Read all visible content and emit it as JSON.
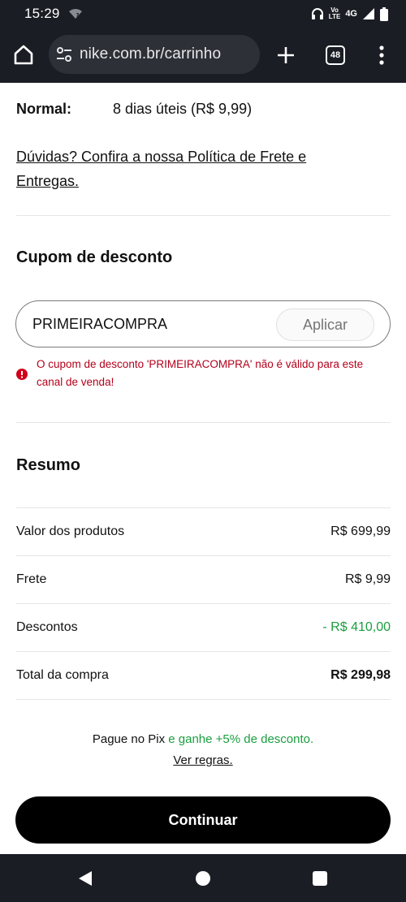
{
  "status_bar": {
    "time": "15:29",
    "network_top": "Vo",
    "network_bottom": "LTE",
    "network_type": "4G"
  },
  "browser": {
    "url": "nike.com.br/carrinho",
    "tab_count": "48"
  },
  "shipping": {
    "label": "Normal:",
    "value": "8 dias úteis (R$ 9,99)",
    "policy_link": "Dúvidas? Confira a nossa Política de Frete e Entregas."
  },
  "coupon": {
    "title": "Cupom de desconto",
    "code": "PRIMEIRACOMPRA",
    "apply_label": "Aplicar",
    "error_message": "O cupom de desconto 'PRIMEIRACOMPRA' não é válido para este canal de venda!"
  },
  "summary": {
    "title": "Resumo",
    "rows": [
      {
        "label": "Valor dos produtos",
        "value": "R$ 699,99"
      },
      {
        "label": "Frete",
        "value": "R$ 9,99"
      },
      {
        "label": "Descontos",
        "value": "- R$ 410,00"
      },
      {
        "label": "Total da compra",
        "value": "R$ 299,98"
      }
    ]
  },
  "pix": {
    "prefix": "Pague no Pix",
    "highlight": "e ganhe +5% de desconto.",
    "rules_link": "Ver regras."
  },
  "checkout": {
    "continue_label": "Continuar"
  },
  "colors": {
    "discount_green": "#1a9e3f",
    "error_red": "#b3001b",
    "chrome_dark": "#1b1d24"
  }
}
